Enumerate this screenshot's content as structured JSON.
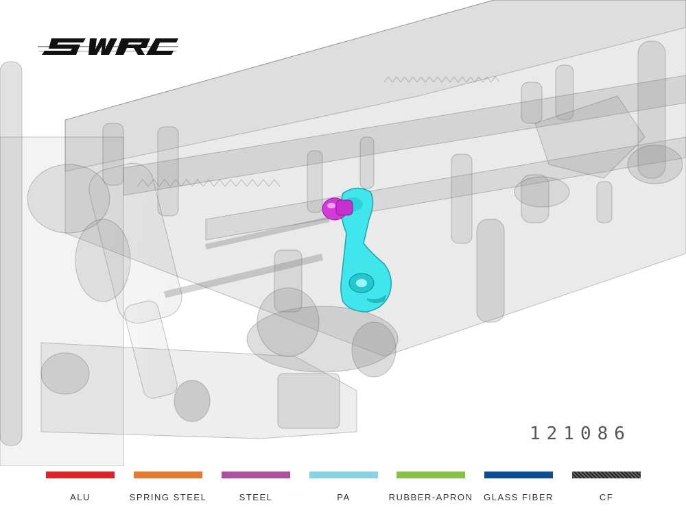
{
  "brand": {
    "logo_text": "SWRC"
  },
  "part_number": "121086",
  "legend": [
    {
      "label": "ALU",
      "color": "#e02327"
    },
    {
      "label": "SPRING STEEL",
      "color": "#e57a30"
    },
    {
      "label": "STEEL",
      "color": "#b04ea0"
    },
    {
      "label": "PA",
      "color": "#86d3e3"
    },
    {
      "label": "RUBBER-APRON",
      "color": "#86c247"
    },
    {
      "label": "GLASS FIBER",
      "color": "#0b4d93"
    },
    {
      "label": "CF",
      "color": "#444444"
    }
  ],
  "highlight": {
    "part_color": "#3fe6ec",
    "fastener_color": "#d23bd8"
  }
}
